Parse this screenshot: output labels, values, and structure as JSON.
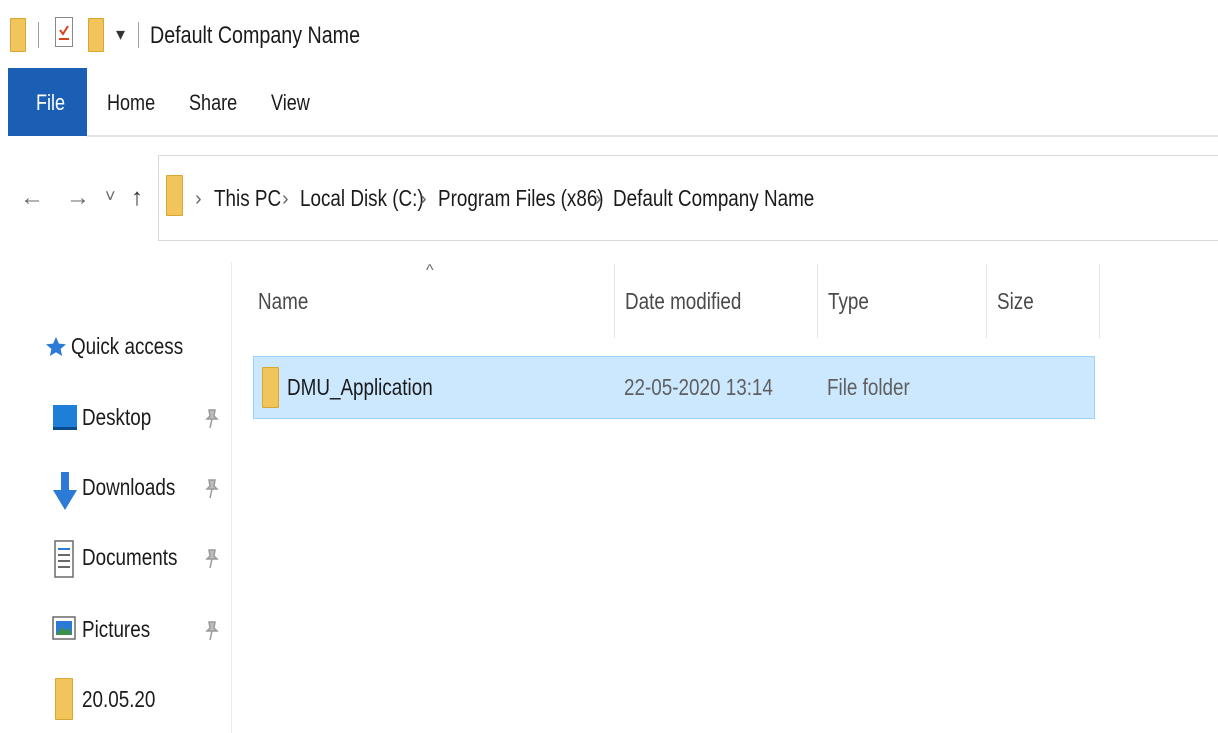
{
  "window": {
    "title": "Default Company Name",
    "customize_toolbar_glyph": "▾"
  },
  "ribbon": {
    "tabs": [
      {
        "label": "File",
        "active": true
      },
      {
        "label": "Home"
      },
      {
        "label": "Share"
      },
      {
        "label": "View"
      }
    ]
  },
  "navigation": {
    "back": "←",
    "forward": "→",
    "recent": "˅",
    "up": "↑",
    "breadcrumbs": [
      "This PC",
      "Local Disk (C:)",
      "Program Files (x86)",
      "Default Company Name"
    ],
    "separator": "›"
  },
  "sidebar": {
    "quick_access": "Quick access",
    "items": [
      {
        "label": "Desktop",
        "icon": "desktop-icon",
        "pinned": true
      },
      {
        "label": "Downloads",
        "icon": "downloads-icon",
        "pinned": true
      },
      {
        "label": "Documents",
        "icon": "documents-icon",
        "pinned": true
      },
      {
        "label": "Pictures",
        "icon": "pictures-icon",
        "pinned": true
      },
      {
        "label": "20.05.20",
        "icon": "folder-icon",
        "pinned": false
      }
    ],
    "pin_glyph": "📌"
  },
  "file_list": {
    "sort_indicator": "^",
    "columns": [
      "Name",
      "Date modified",
      "Type",
      "Size"
    ],
    "rows": [
      {
        "name": "DMU_Application",
        "date_modified": "22-05-2020 13:14",
        "type": "File folder",
        "size": "",
        "selected": true
      }
    ]
  },
  "colors": {
    "accent": "#1a5fb4",
    "selection": "#cce8ff",
    "folder": "#f2c55c"
  }
}
